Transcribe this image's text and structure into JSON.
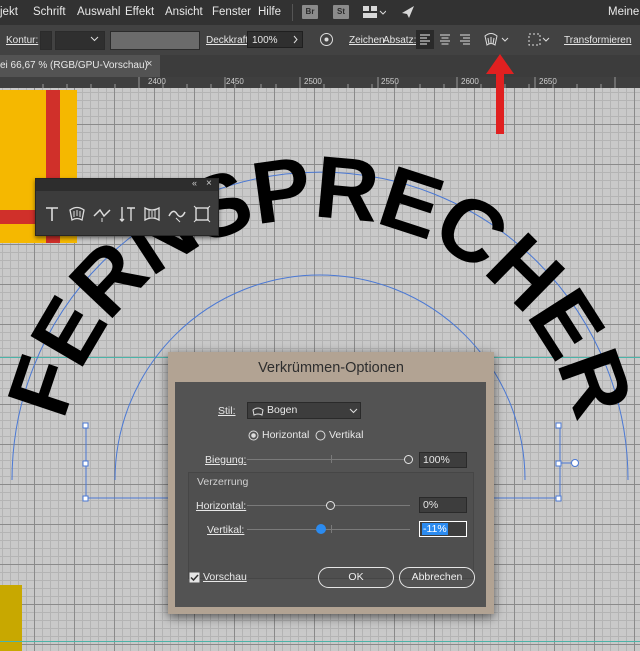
{
  "menu": [
    "jekt",
    "Schrift",
    "Auswahl",
    "Effekt",
    "Ansicht",
    "Fenster",
    "Hilfe"
  ],
  "menu_right": "Meiner",
  "bridge": {
    "br": "Br",
    "st": "St"
  },
  "controlbar": {
    "kontur_label": "Kontur:",
    "deckkraft_label": "Deckkraft:",
    "deckkraft_value": "100%",
    "zeichen_label": "Zeichen",
    "absatz_label": "Absatz:",
    "transformieren_label": "Transformieren"
  },
  "doc_tab": {
    "title": "ei 66,67 % (RGB/GPU-Vorschau)",
    "close": "×"
  },
  "ruler": [
    "2400",
    "2450",
    "2500",
    "2550",
    "2600",
    "2650"
  ],
  "artwork": {
    "text": "FERNSPRECHER",
    "color": "#000000"
  },
  "envelope_tools": {
    "collapse": "«",
    "close": "×",
    "icons": [
      "text-icon",
      "arc-envelope-icon",
      "twist-icon",
      "vertical-text-icon",
      "flag-envelope-icon",
      "wave-icon",
      "envelope-grid-icon"
    ]
  },
  "dialog": {
    "title": "Verkrümmen-Optionen",
    "stil_label": "Stil:",
    "stil_value": "Bogen",
    "horizontal_radio": "Horizontal",
    "vertikal_radio": "Vertikal",
    "selected_orientation": "Horizontal",
    "biegung_label": "Biegung:",
    "biegung_value": "100%",
    "biegung_level": 100,
    "verzerrung_label": "Verzerrung",
    "horizontal_label": "Horizontal:",
    "horizontal_value": "0%",
    "horizontal_level": 0,
    "vertikal_label": "Vertikal:",
    "vertikal_value": "-11%",
    "vertikal_level": -11,
    "vorschau_label": "Vorschau",
    "vorschau_checked": true,
    "ok_label": "OK",
    "abbrechen_label": "Abbrechen"
  },
  "colors": {
    "accent_red": "#e02020",
    "yellow": "#f5b800",
    "selection_blue": "#4a78d4",
    "slider_blue": "#2b8bf0"
  }
}
